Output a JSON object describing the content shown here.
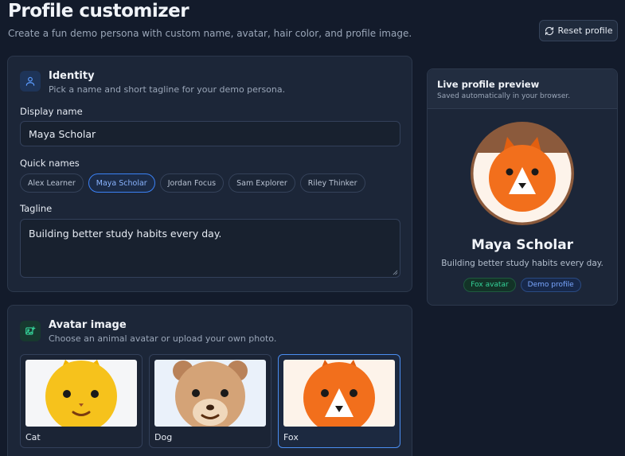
{
  "header": {
    "title": "Profile customizer",
    "subtitle": "Create a fun demo persona with custom name, avatar, hair color, and profile image.",
    "reset_label": "Reset profile"
  },
  "identity": {
    "title": "Identity",
    "description": "Pick a name and short tagline for your demo persona.",
    "display_name_label": "Display name",
    "display_name_value": "Maya Scholar",
    "quick_names_label": "Quick names",
    "quick_names": [
      "Alex Learner",
      "Maya Scholar",
      "Jordan Focus",
      "Sam Explorer",
      "Riley Thinker"
    ],
    "selected_quick_name": "Maya Scholar",
    "tagline_label": "Tagline",
    "tagline_value": "Building better study habits every day."
  },
  "avatar": {
    "title": "Avatar image",
    "description": "Choose an animal avatar or upload your own photo.",
    "options": [
      {
        "name": "Cat",
        "icon": "cat-avatar-icon"
      },
      {
        "name": "Dog",
        "icon": "dog-avatar-icon"
      },
      {
        "name": "Fox",
        "icon": "fox-avatar-icon"
      }
    ],
    "selected": "Fox"
  },
  "preview": {
    "title": "Live profile preview",
    "subtitle": "Saved automatically in your browser.",
    "name": "Maya Scholar",
    "tagline": "Building better study habits every day.",
    "badges": [
      "Fox avatar",
      "Demo profile"
    ]
  },
  "colors": {
    "background": "#131b2b",
    "card": "#1c2638",
    "accent_blue": "#3b82f6",
    "accent_green": "#34d399",
    "fox_orange": "#f26f1c",
    "hair_brown": "#8b5a3c"
  }
}
